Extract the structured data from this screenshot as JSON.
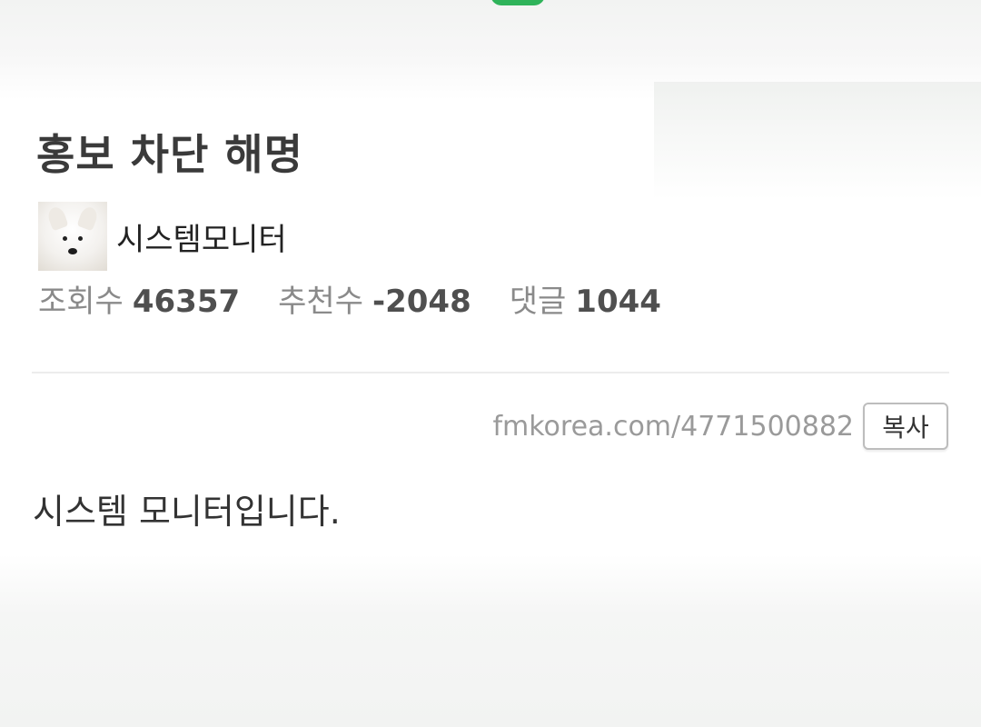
{
  "post": {
    "title": "홍보 차단 해명",
    "author": {
      "name": "시스템모니터",
      "avatar_icon": "samoyed-dog-avatar"
    },
    "stats": [
      {
        "label": "조회수",
        "value": "46357"
      },
      {
        "label": "추천수",
        "value": "-2048"
      },
      {
        "label": "댓글",
        "value": "1044"
      }
    ],
    "url": "fmkorea.com/4771500882",
    "copy_label": "복사",
    "body": "시스템 모니터입니다."
  },
  "colors": {
    "background": "#ffffff",
    "title": "#3a3a3a",
    "stat_label": "#8a8a8a",
    "stat_value": "#4f4f4f",
    "url": "#9a9a9a",
    "accent_scribble": "#2fb35a"
  }
}
